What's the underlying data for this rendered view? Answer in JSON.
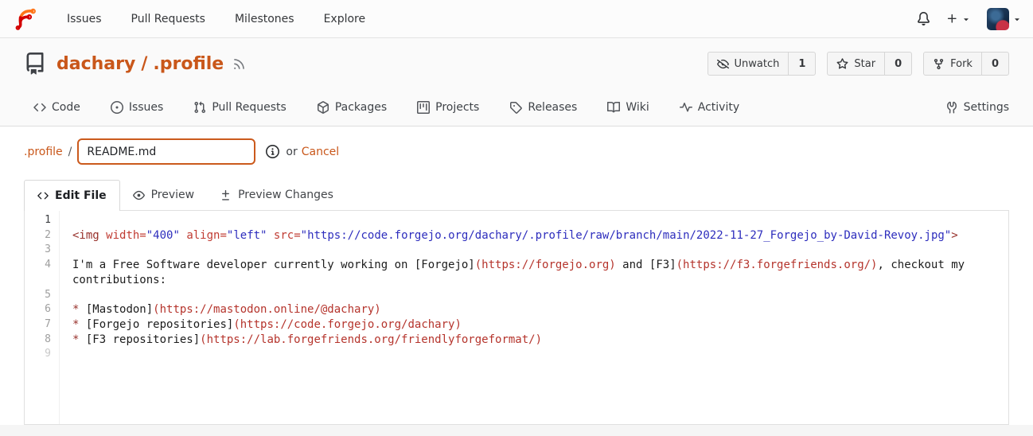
{
  "theme": {
    "accent": "#c9571a",
    "navbar_bg": "#fcfcfc",
    "header_bg": "#fafafa",
    "syntax": {
      "tag": "#97302a",
      "attribute": "#c03b32",
      "string": "#2d2dbd",
      "link_url": "#b5342c",
      "list_marker": "#97302a",
      "text": "#1c1c1c"
    }
  },
  "navbar": {
    "items": [
      "Issues",
      "Pull Requests",
      "Milestones",
      "Explore"
    ]
  },
  "repo": {
    "owner": "dachary",
    "separator": "/",
    "name": ".profile",
    "actions": [
      {
        "id": "unwatch",
        "icon": "eye-slash-icon",
        "label": "Unwatch",
        "count": "1"
      },
      {
        "id": "star",
        "icon": "star-icon",
        "label": "Star",
        "count": "0"
      },
      {
        "id": "fork",
        "icon": "fork-icon",
        "label": "Fork",
        "count": "0"
      }
    ],
    "tabs": [
      {
        "id": "code",
        "icon": "code-icon",
        "label": "Code"
      },
      {
        "id": "issues",
        "icon": "issue-icon",
        "label": "Issues"
      },
      {
        "id": "pull-requests",
        "icon": "pull-request-icon",
        "label": "Pull Requests"
      },
      {
        "id": "packages",
        "icon": "package-icon",
        "label": "Packages"
      },
      {
        "id": "projects",
        "icon": "project-icon",
        "label": "Projects"
      },
      {
        "id": "releases",
        "icon": "tag-icon",
        "label": "Releases"
      },
      {
        "id": "wiki",
        "icon": "book-icon",
        "label": "Wiki"
      },
      {
        "id": "activity",
        "icon": "pulse-icon",
        "label": "Activity"
      }
    ],
    "settings_label": "Settings"
  },
  "file_header": {
    "breadcrumb_dir": ".profile",
    "separator": "/",
    "filename_value": "README.md",
    "or_text": "or",
    "cancel_label": "Cancel"
  },
  "editor_tabs": [
    {
      "id": "edit-file",
      "icon": "code-icon",
      "label": "Edit File",
      "active": true
    },
    {
      "id": "preview",
      "icon": "eye-icon",
      "label": "Preview",
      "active": false
    },
    {
      "id": "preview-changes",
      "icon": "diff-icon",
      "label": "Preview Changes",
      "active": false
    }
  ],
  "editor": {
    "lines": [
      {
        "num": "1",
        "state": "active",
        "segments": []
      },
      {
        "num": "2",
        "state": "normal",
        "segments": [
          {
            "c": "tag",
            "t": "<img"
          },
          {
            "c": "plain",
            "t": " "
          },
          {
            "c": "attr",
            "t": "width="
          },
          {
            "c": "str",
            "t": "\"400\""
          },
          {
            "c": "plain",
            "t": " "
          },
          {
            "c": "attr",
            "t": "align="
          },
          {
            "c": "str",
            "t": "\"left\""
          },
          {
            "c": "plain",
            "t": " "
          },
          {
            "c": "attr",
            "t": "src="
          },
          {
            "c": "str",
            "t": "\"https://code.forgejo.org/dachary/.profile/raw/branch/main/2022-11-27_Forgejo_by-David-Revoy.jpg\""
          },
          {
            "c": "tag",
            "t": ">"
          }
        ]
      },
      {
        "num": "3",
        "state": "normal",
        "segments": []
      },
      {
        "num": "4",
        "state": "normal",
        "segments": [
          {
            "c": "plain",
            "t": "I'm a Free Software developer currently working on "
          },
          {
            "c": "plain",
            "t": "[Forgejo]"
          },
          {
            "c": "url",
            "t": "(https://forgejo.org)"
          },
          {
            "c": "plain",
            "t": " and "
          },
          {
            "c": "plain",
            "t": "[F3]"
          },
          {
            "c": "url",
            "t": "(https://f3.forgefriends.org/)"
          },
          {
            "c": "plain",
            "t": ", checkout my contributions:"
          }
        ]
      },
      {
        "num": "5",
        "state": "normal",
        "segments": []
      },
      {
        "num": "6",
        "state": "normal",
        "segments": [
          {
            "c": "li",
            "t": "*"
          },
          {
            "c": "plain",
            "t": " [Mastodon]"
          },
          {
            "c": "url",
            "t": "(https://mastodon.online/@dachary)"
          }
        ]
      },
      {
        "num": "7",
        "state": "normal",
        "segments": [
          {
            "c": "li",
            "t": "*"
          },
          {
            "c": "plain",
            "t": " [Forgejo repositories]"
          },
          {
            "c": "url",
            "t": "(https://code.forgejo.org/dachary)"
          }
        ]
      },
      {
        "num": "8",
        "state": "normal",
        "segments": [
          {
            "c": "li",
            "t": "*"
          },
          {
            "c": "plain",
            "t": " [F3 repositories]"
          },
          {
            "c": "url",
            "t": "(https://lab.forgefriends.org/friendlyforgeformat/)"
          }
        ]
      },
      {
        "num": "9",
        "state": "dim",
        "segments": []
      }
    ]
  }
}
